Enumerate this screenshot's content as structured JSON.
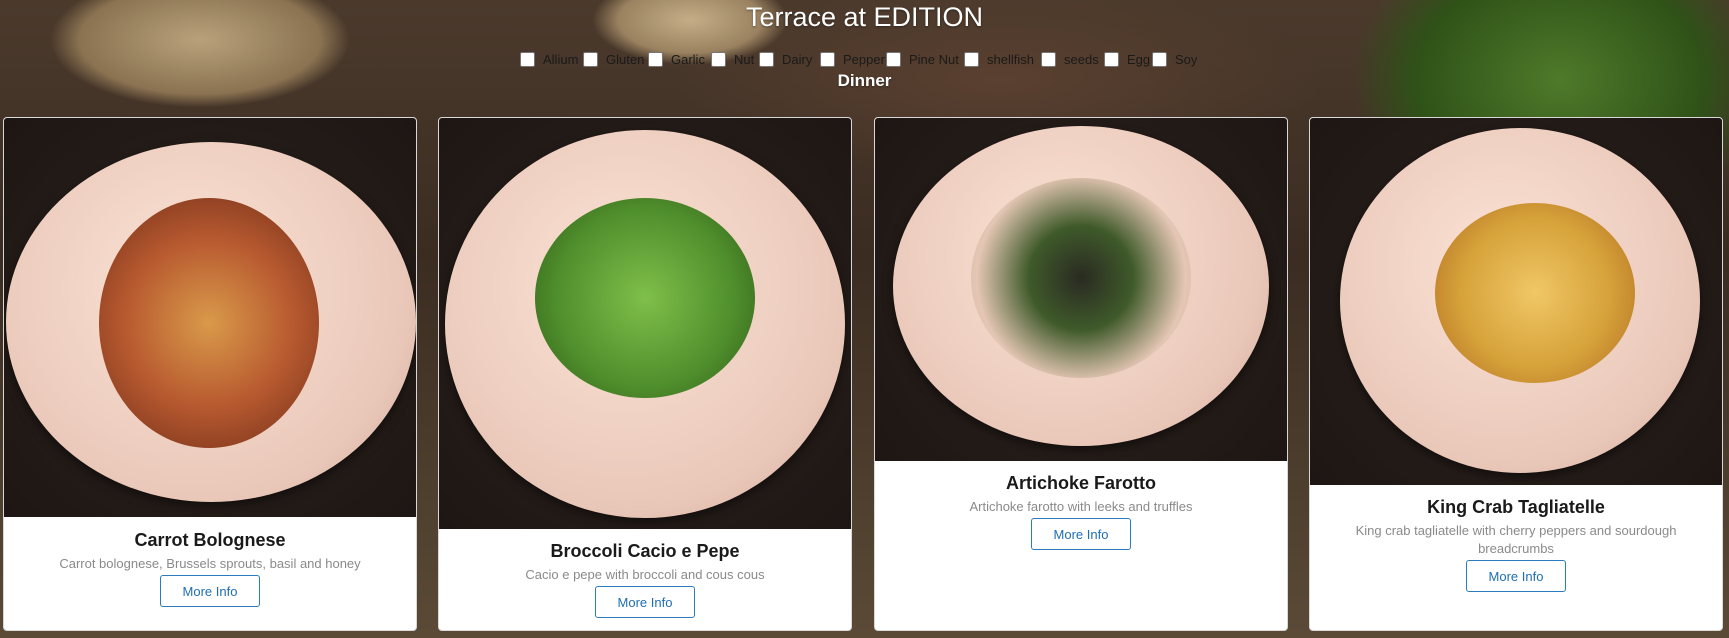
{
  "page": {
    "title": "Terrace at EDITION",
    "meal": "Dinner"
  },
  "filters": [
    {
      "label": "Allium",
      "checked": false
    },
    {
      "label": "Gluten",
      "checked": false
    },
    {
      "label": "Garlic",
      "checked": false
    },
    {
      "label": "Nut",
      "checked": false
    },
    {
      "label": "Dairy",
      "checked": false
    },
    {
      "label": "Pepper",
      "checked": false
    },
    {
      "label": "Pine Nut",
      "checked": false
    },
    {
      "label": "shellfish",
      "checked": false
    },
    {
      "label": "seeds",
      "checked": false
    },
    {
      "label": "Egg",
      "checked": false
    },
    {
      "label": "Soy",
      "checked": false
    }
  ],
  "dishes": [
    {
      "name": "Carrot Bolognese",
      "description": "Carrot bolognese, Brussels sprouts, basil and honey",
      "button": "More Info",
      "food_color": "#a04a2a"
    },
    {
      "name": "Broccoli Cacio e Pepe",
      "description": "Cacio e pepe with broccoli and cous cous",
      "button": "More Info",
      "food_color": "#4f8e2c"
    },
    {
      "name": "Artichoke Farotto",
      "description": "Artichoke farotto with leeks and truffles",
      "button": "More Info",
      "food_color": "#d9b3a2"
    },
    {
      "name": "King Crab Tagliatelle",
      "description": "King crab tagliatelle with cherry peppers and sourdough breadcrumbs",
      "button": "More Info",
      "food_color": "#d6a23a"
    }
  ],
  "colors": {
    "button_border": "#2a7bbf",
    "button_text": "#1f6eb3",
    "title_text": "#ffffff"
  }
}
